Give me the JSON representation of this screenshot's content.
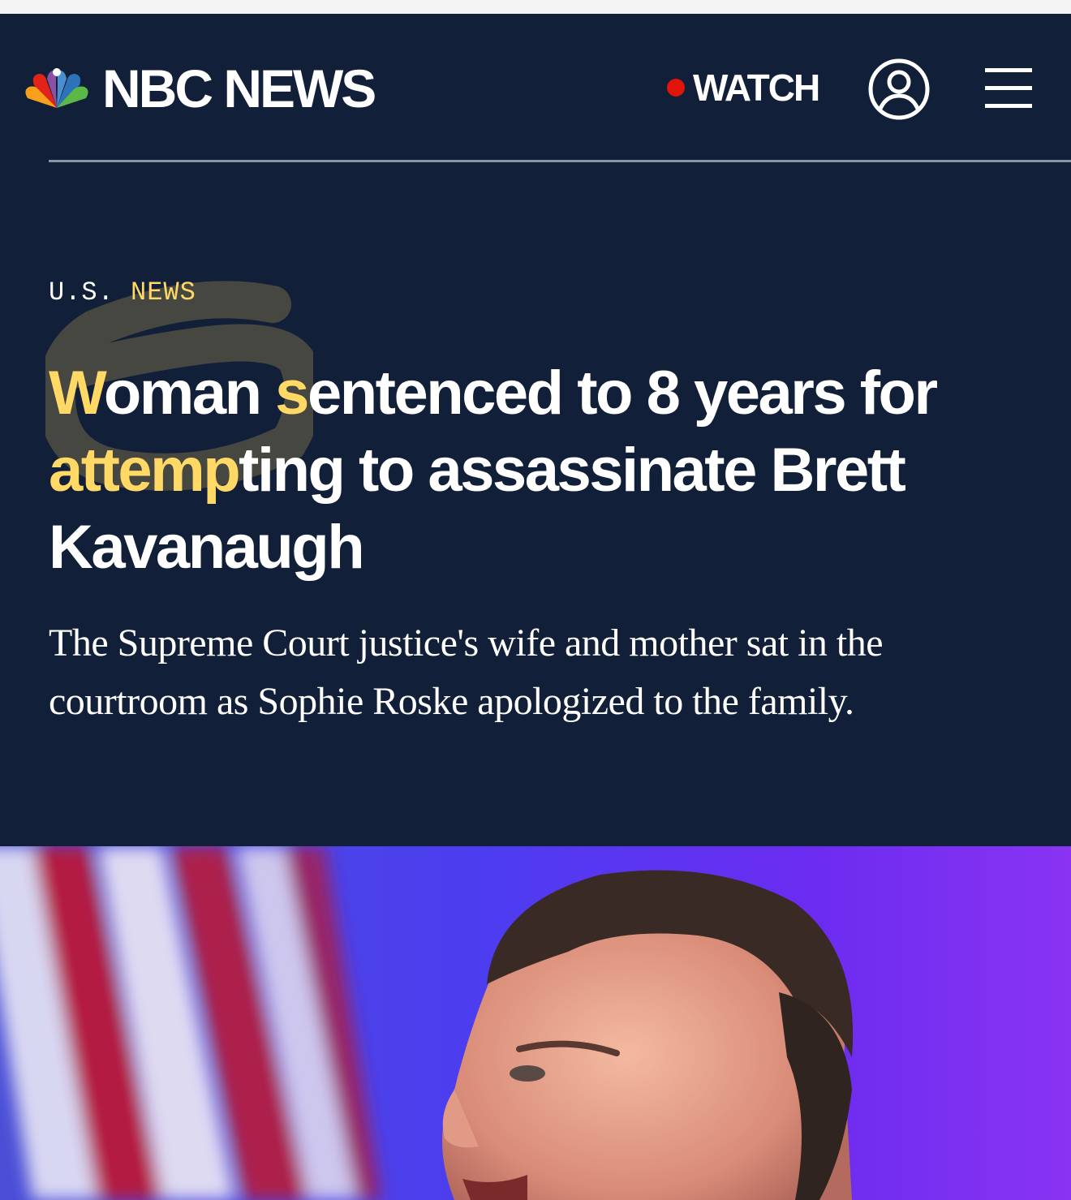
{
  "header": {
    "brand": "NBC NEWS",
    "watch_label": "WATCH",
    "account_icon": "account-icon",
    "menu_icon": "menu-icon",
    "logo_icon": "nbc-peacock-icon"
  },
  "article": {
    "eyebrow_prefix": "U.S.",
    "eyebrow_section": "NEWS",
    "headline": {
      "hl1": "W",
      "t1": "oman ",
      "hl2": "s",
      "t2": "entenced to 8 years for ",
      "hl3": "attemp",
      "t3": "ting to assassinate Brett Kavanaugh"
    },
    "dek": "The Supreme Court justice's wife and mother sat in the courtroom as Sophie Roske apologized to the family."
  },
  "colors": {
    "background": "#121f38",
    "accent": "#ffd866",
    "live": "#e1140a"
  }
}
